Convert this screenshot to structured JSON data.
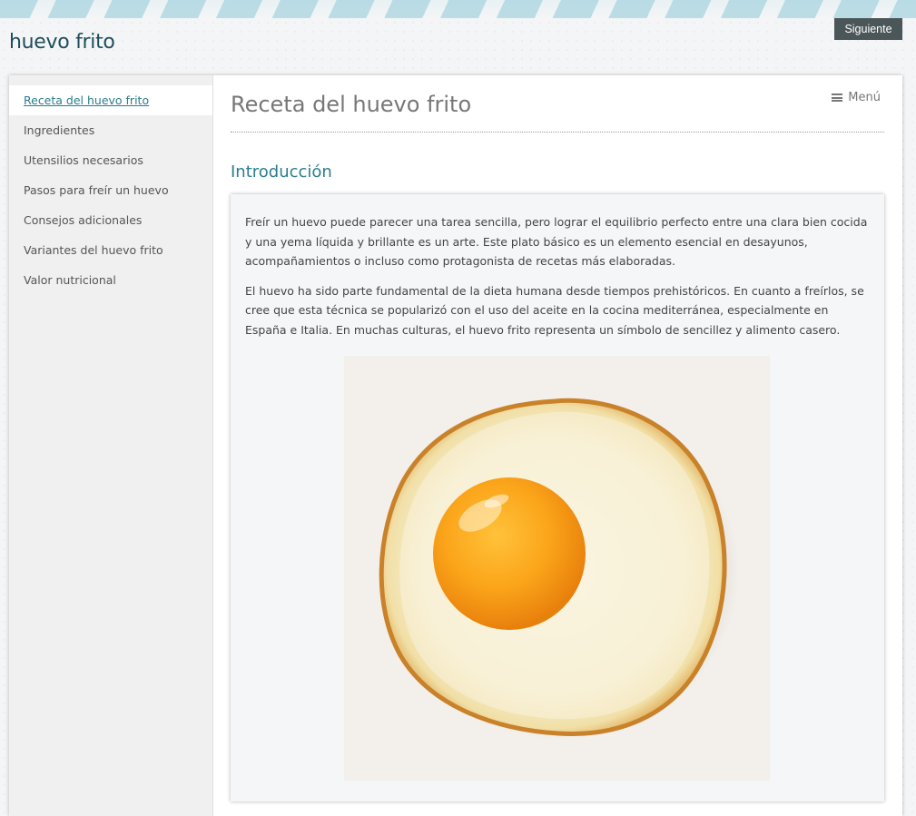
{
  "site": {
    "title": "huevo frito"
  },
  "header": {
    "next_label": "Siguiente"
  },
  "sidebar": {
    "items": [
      {
        "label": "Receta del huevo frito",
        "active": true
      },
      {
        "label": "Ingredientes",
        "active": false
      },
      {
        "label": "Utensilios necesarios",
        "active": false
      },
      {
        "label": "Pasos para freír un huevo",
        "active": false
      },
      {
        "label": "Consejos adicionales",
        "active": false
      },
      {
        "label": "Variantes del huevo frito",
        "active": false
      },
      {
        "label": "Valor nutricional",
        "active": false
      }
    ]
  },
  "main": {
    "page_title": "Receta del huevo frito",
    "menu_label": "Menú",
    "section_heading": "Introducción",
    "paragraphs": [
      "Freír un huevo puede parecer una tarea sencilla, pero lograr el equilibrio perfecto entre una clara bien cocida y una yema líquida y brillante es un arte. Este plato básico es un elemento esencial en desayunos, acompañamientos o incluso como protagonista de recetas más elaboradas.",
      "El huevo ha sido parte fundamental de la dieta humana desde tiempos prehistóricos. En cuanto a freírlos, se cree que esta técnica se popularizó con el uso del aceite en la cocina mediterránea, especialmente en España e Italia. En muchas culturas, el huevo frito representa un símbolo de sencillez y alimento casero."
    ]
  },
  "colors": {
    "accent": "#2a7d8e",
    "title_dark": "#1f4e5a",
    "button_bg": "#4b5658",
    "sidebar_bg": "#f0f0f0",
    "card_bg": "#f5f6f8"
  },
  "icons": {
    "menu": "hamburger-icon",
    "image": "fried-egg-image"
  }
}
